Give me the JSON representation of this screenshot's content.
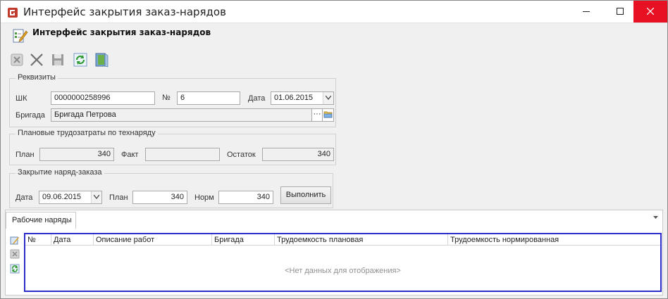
{
  "window": {
    "title": "Интерфейс закрытия заказ-нарядов",
    "accent_close": "#e81123"
  },
  "header": {
    "title": "Интерфейс закрытия заказ-нарядов",
    "icon": "edit-document-icon"
  },
  "toolbar": {
    "items": [
      {
        "name": "cancel-icon"
      },
      {
        "name": "delete-icon"
      },
      {
        "name": "save-icon"
      },
      {
        "name": "refresh-icon"
      },
      {
        "name": "exit-icon"
      }
    ]
  },
  "requisites": {
    "title": "Реквизиты",
    "shk_label": "ШК",
    "shk_value": "0000000258996",
    "number_label": "№",
    "number_value": "6",
    "date_label": "Дата",
    "date_value": "01.06.2015",
    "brigade_label": "Бригада",
    "brigade_value": "Бригада Петрова",
    "ellipsis": "···"
  },
  "planned": {
    "title": "Плановые трудозатраты по технаряду",
    "plan_label": "План",
    "plan_value": "340",
    "fact_label": "Факт",
    "fact_value": "",
    "rest_label": "Остаток",
    "rest_value": "340"
  },
  "closing": {
    "title": "Закрытие наряд-заказа",
    "date_label": "Дата",
    "date_value": "09.06.2015",
    "plan_label": "План",
    "plan_value": "340",
    "norm_label": "Норм",
    "norm_value": "340",
    "execute_label": "Выполнить"
  },
  "tabs": {
    "active": "Рабочие наряды"
  },
  "grid": {
    "columns": [
      "№",
      "Дата",
      "Описание работ",
      "Бригада",
      "Трудоемкость плановая",
      "Трудоемкость нормированная"
    ],
    "empty_text": "<Нет данных для отображения>"
  }
}
